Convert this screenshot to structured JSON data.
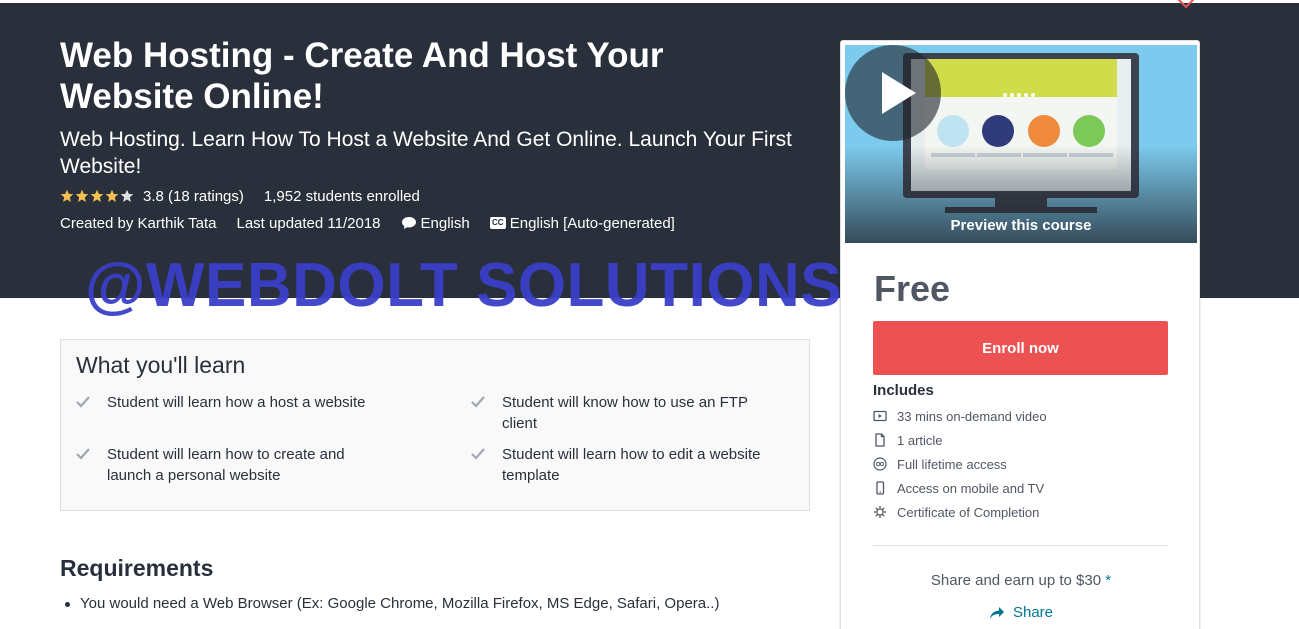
{
  "course": {
    "title": "Web Hosting - Create And Host Your Website Online!",
    "subtitle": "Web Hosting. Learn How To Host a Website And Get Online. Launch Your First Website!",
    "rating": 3.8,
    "rating_text": "3.8 (18 ratings)",
    "enrolled": "1,952 students enrolled",
    "created_by": "Created by Karthik Tata",
    "last_updated": "Last updated 11/2018",
    "language": "English",
    "captions": "English [Auto-generated]",
    "captions_badge": "CC"
  },
  "watermark": "@WEBDOLT SOLUTIONS",
  "learn": {
    "title": "What you'll learn",
    "items": [
      "Student will learn how a host a website",
      "Student will know how to use an FTP client",
      "Student will learn how to create and launch a personal website",
      "Student will learn how to edit a website template"
    ]
  },
  "requirements": {
    "title": "Requirements",
    "items": [
      "You would need a Web Browser (Ex: Google Chrome, Mozilla Firefox, MS Edge, Safari, Opera..)"
    ]
  },
  "sidebar": {
    "preview_label": "Preview this course",
    "price": "Free",
    "enroll_label": "Enroll now",
    "includes_title": "Includes",
    "includes": [
      {
        "icon": "video-icon",
        "text": "33 mins on-demand video"
      },
      {
        "icon": "file-icon",
        "text": "1 article"
      },
      {
        "icon": "infinity-icon",
        "text": "Full lifetime access"
      },
      {
        "icon": "mobile-icon",
        "text": "Access on mobile and TV"
      },
      {
        "icon": "certificate-icon",
        "text": "Certificate of Completion"
      }
    ],
    "share_earn": "Share and earn up to $30",
    "share_asterisk": "*",
    "share_label": "Share"
  },
  "colors": {
    "hero_bg": "#29303b",
    "enroll_bg": "#ec5252",
    "link": "#007791",
    "star": "#f4c150",
    "watermark": "#3a3fc8"
  }
}
